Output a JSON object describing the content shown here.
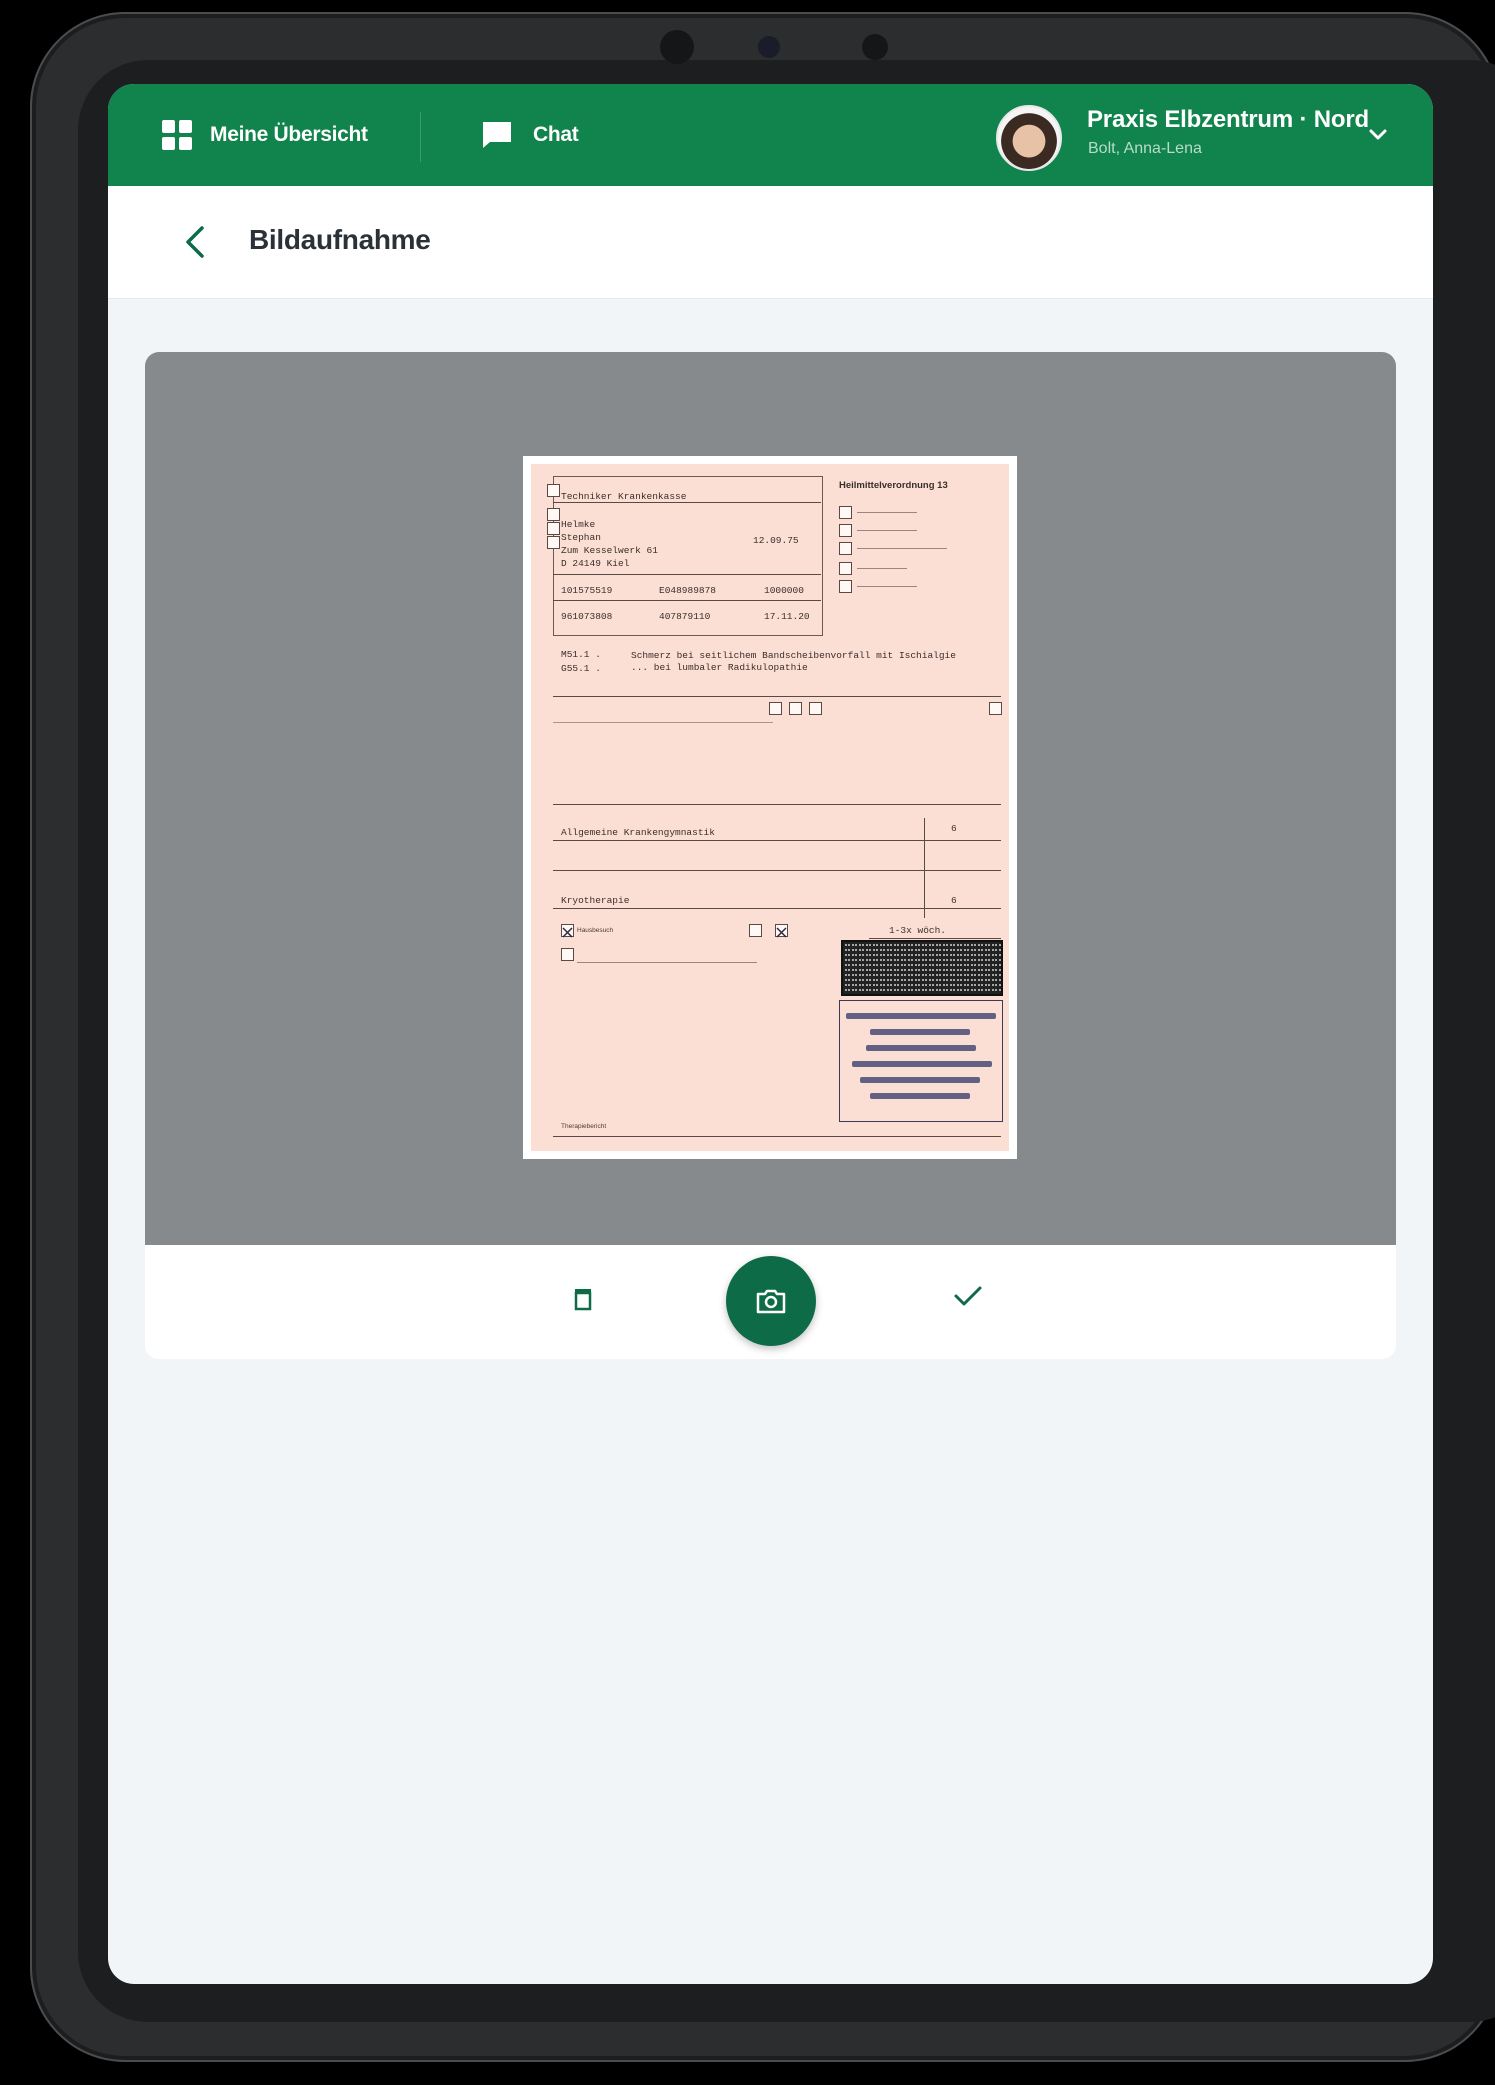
{
  "topbar": {
    "overview_label": "Meine Übersicht",
    "chat_label": "Chat",
    "practice_name": "Praxis Elbzentrum · Nord",
    "user_name": "Bolt, Anna-Lena"
  },
  "page": {
    "title": "Bildaufnahme"
  },
  "document": {
    "header_title": "Heilmittelverordnung 13",
    "insurer": "Techniker Krankenkasse",
    "patient_last": "Helmke",
    "patient_first": "Stephan",
    "street": "Zum Kesselwerk 61",
    "city": "D 24149 Kiel",
    "birthdate": "12.09.75",
    "ids_row1": [
      "101575519",
      "E048989878",
      "1000000"
    ],
    "ids_row2": [
      "961073808",
      "407879110",
      "17.11.20"
    ],
    "icd": [
      "M51.1 .",
      "G55.1 ."
    ],
    "diagnosis": "Schmerz bei seitlichem Bandscheibenvorfall mit Ischialgie ... bei lumbaler Radikulopathie",
    "therapy": "Allgemeine Krankengymnastik",
    "therapy_count": "6",
    "extra": "Kryotherapie",
    "extra_count": "6",
    "frequency": "1-3x wöch.",
    "checked_label": "Hausbesuch",
    "footer_note": "Therapiebericht"
  },
  "actions": {
    "delete": "delete",
    "capture": "capture",
    "confirm": "confirm"
  },
  "colors": {
    "brand_green": "#11834d",
    "capture_green": "#0d6b47",
    "viewer_gray": "#868a8d",
    "form_pink": "#fcdfd4"
  }
}
